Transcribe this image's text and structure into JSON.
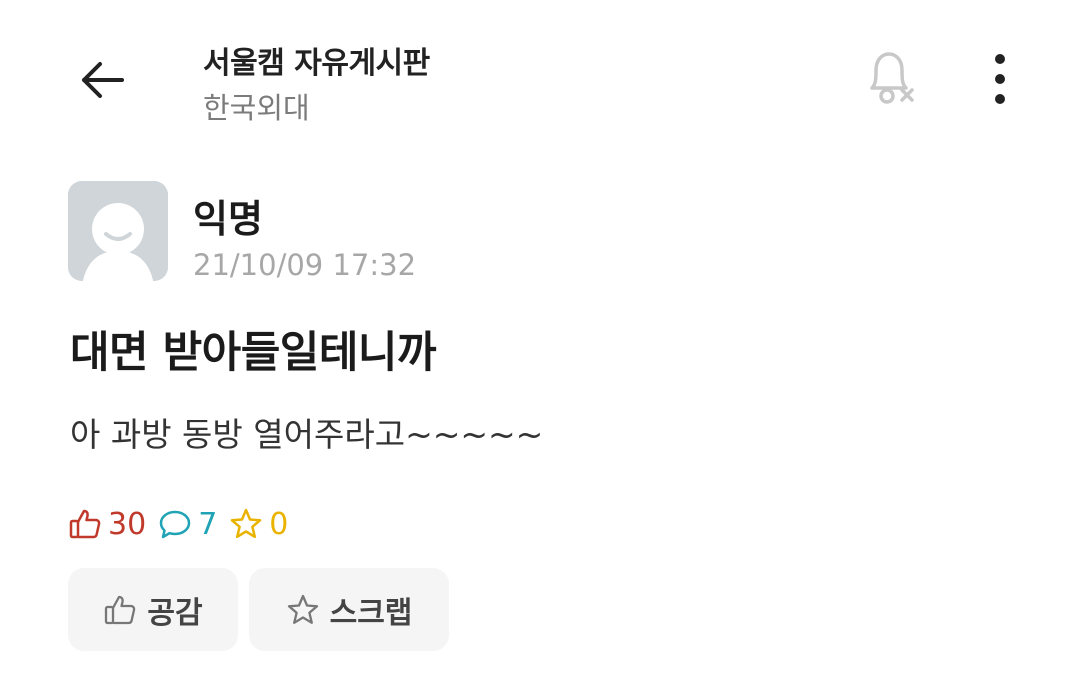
{
  "header": {
    "back_icon": "arrow-left-icon",
    "board_title": "서울캠 자유게시판",
    "board_subtitle": "한국외대",
    "notification_icon": "bell-off-icon",
    "more_icon": "more-vertical-icon"
  },
  "post": {
    "author": "익명",
    "timestamp": "21/10/09 17:32",
    "title": "대면 받아들일테니까",
    "body": "아 과방 동방 열어주라고~~~~~",
    "stats": {
      "likes": "30",
      "comments": "7",
      "scraps": "0"
    }
  },
  "actions": {
    "like_label": "공감",
    "scrap_label": "스크랩"
  },
  "colors": {
    "like": "#c0392b",
    "comment": "#1fa3b5",
    "scrap": "#e9b300",
    "button_bg": "#f5f5f5"
  }
}
